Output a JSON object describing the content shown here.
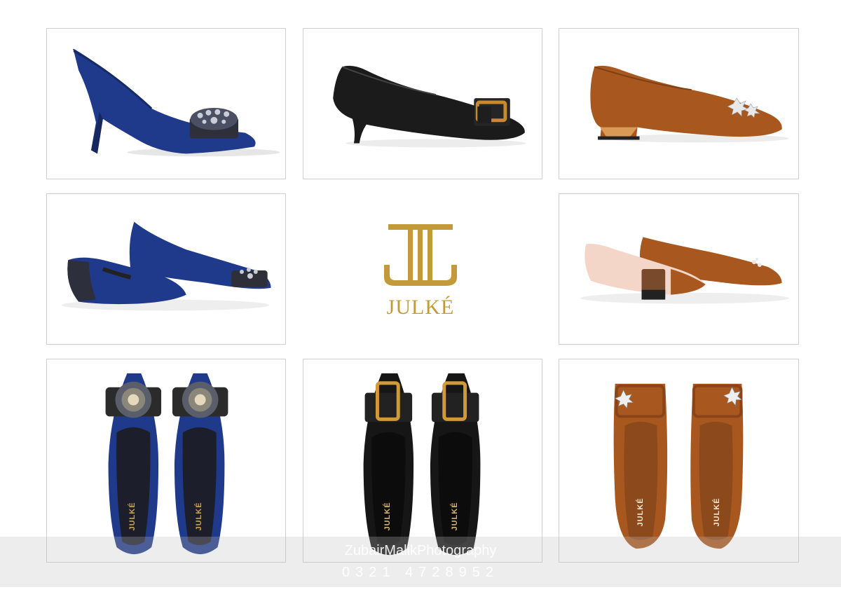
{
  "brand": {
    "name": "JULKÉ",
    "gold": "#c29a3a"
  },
  "panels": [
    {
      "label": "blue-suede-pump-side",
      "color": "#1f3a8a"
    },
    {
      "label": "black-leather-kitten-heel-side",
      "color": "#1a1a1a"
    },
    {
      "label": "tan-suede-block-heel-side",
      "color": "#a8581f"
    },
    {
      "label": "blue-suede-pump-pair",
      "color": "#1f3a8a"
    },
    {
      "label": "tan-suede-block-heel-pair",
      "color": "#a8581f"
    },
    {
      "label": "blue-suede-pump-top",
      "color": "#1f3a8a"
    },
    {
      "label": "black-leather-kitten-heel-top",
      "color": "#1a1a1a"
    },
    {
      "label": "tan-suede-block-heel-top",
      "color": "#a8581f"
    }
  ],
  "insole_brand": "JULKÉ",
  "watermark": {
    "name": "ZubairMalikPhotography",
    "phone": "0321 4728952"
  }
}
